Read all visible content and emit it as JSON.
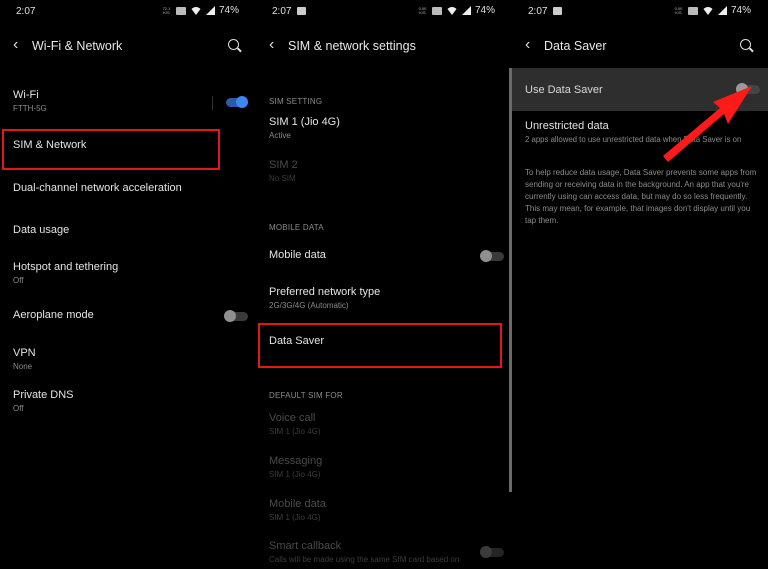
{
  "status_bar": {
    "time": "2:07",
    "battery": "74%",
    "speed_unit": "K/S",
    "icons": [
      "gallery-icon",
      "data-speed-icon",
      "volte-icon",
      "wifi-icon",
      "signal-icon"
    ]
  },
  "panel1": {
    "title": "Wi-Fi & Network",
    "back_icon": "‹",
    "items": [
      {
        "label": "Wi-Fi",
        "sub": "FTTH-5G",
        "toggle": true
      },
      {
        "label": "SIM & Network",
        "sub": ""
      },
      {
        "label": "Dual-channel network acceleration",
        "sub": ""
      },
      {
        "label": "Data usage",
        "sub": ""
      },
      {
        "label": "Hotspot and tethering",
        "sub": "Off"
      },
      {
        "label": "Aeroplane mode",
        "sub": "",
        "toggle": false
      },
      {
        "label": "VPN",
        "sub": "None"
      },
      {
        "label": "Private DNS",
        "sub": "Off"
      }
    ]
  },
  "panel2": {
    "title": "SIM & network settings",
    "back_icon": "‹",
    "sections": {
      "sim_setting": "SIM SETTING",
      "mobile_data": "MOBILE DATA",
      "default_sim": "DEFAULT SIM FOR"
    },
    "items": {
      "sim1": {
        "label": "SIM 1 (Jio 4G)",
        "sub": "Active"
      },
      "sim2": {
        "label": "SIM 2",
        "sub": "No SIM"
      },
      "mobile_data": {
        "label": "Mobile data",
        "toggle": false
      },
      "network_type": {
        "label": "Preferred network type",
        "sub": "2G/3G/4G (Automatic)"
      },
      "data_saver": {
        "label": "Data Saver"
      },
      "voice_call": {
        "label": "Voice call",
        "sub": "SIM 1 (Jio 4G)"
      },
      "messaging": {
        "label": "Messaging",
        "sub": "SIM 1 (Jio 4G)"
      },
      "mobile_data_default": {
        "label": "Mobile data",
        "sub": "SIM 1 (Jio 4G)"
      },
      "smart_callback": {
        "label": "Smart callback",
        "sub": "Calls will be made using the same SIM card based on",
        "toggle": false
      }
    }
  },
  "panel3": {
    "title": "Data Saver",
    "back_icon": "‹",
    "use_data_saver": {
      "label": "Use Data Saver",
      "toggle": false
    },
    "unrestricted": {
      "label": "Unrestricted data",
      "sub": "2 apps allowed to use unrestricted data when Data Saver is on"
    },
    "description": "To help reduce data usage, Data Saver prevents some apps from sending or receiving data in the background. An app that you're currently using can access data, but may do so less frequently. This may mean, for example, that images don't display until you tap them."
  },
  "annotations": {
    "highlight_color": "#e01818",
    "arrow_color": "#ff1a1a"
  }
}
